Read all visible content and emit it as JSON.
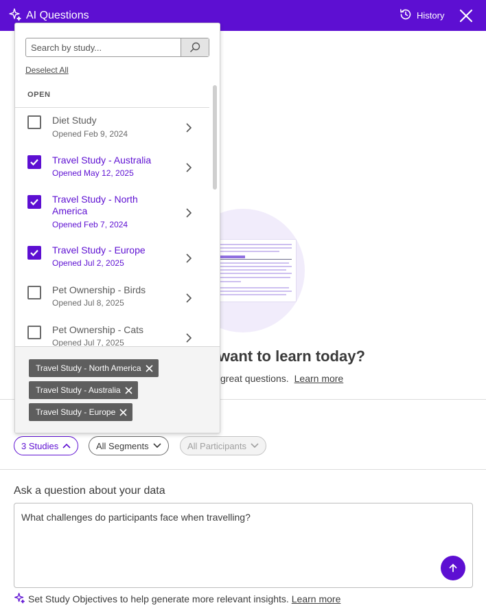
{
  "header": {
    "title": "AI Questions",
    "history_label": "History"
  },
  "background": {
    "heading_fragment": "want to learn today?",
    "subline_fragment": "great questions.",
    "learn_more": "Learn more"
  },
  "filters": {
    "studies": "3 Studies",
    "segments": "All Segments",
    "participants": "All Participants"
  },
  "question": {
    "label": "Ask a question about your data",
    "value": "What challenges do participants face when travelling?"
  },
  "objectives": {
    "text": "Set Study Objectives to help generate more relevant insights.",
    "link": "Learn more"
  },
  "dropdown": {
    "search_placeholder": "Search by study...",
    "deselect_all": "Deselect All",
    "section": "OPEN",
    "studies": [
      {
        "name": "Diet Study",
        "date": "Opened Feb 9, 2024",
        "checked": false
      },
      {
        "name": "Travel Study - Australia",
        "date": "Opened May 12, 2025",
        "checked": true
      },
      {
        "name": "Travel Study - North America",
        "date": "Opened Feb 7, 2024",
        "checked": true
      },
      {
        "name": "Travel Study - Europe",
        "date": "Opened Jul 2, 2025",
        "checked": true
      },
      {
        "name": "Pet Ownership - Birds",
        "date": "Opened Jul 8, 2025",
        "checked": false
      },
      {
        "name": "Pet Ownership - Cats",
        "date": "Opened Jul 7, 2025",
        "checked": false
      }
    ],
    "selected_tags": [
      "Travel Study - North America",
      "Travel Study - Australia",
      "Travel Study - Europe"
    ]
  },
  "colors": {
    "brand": "#5d0fd2",
    "tag_bg": "#5e5e5e"
  }
}
